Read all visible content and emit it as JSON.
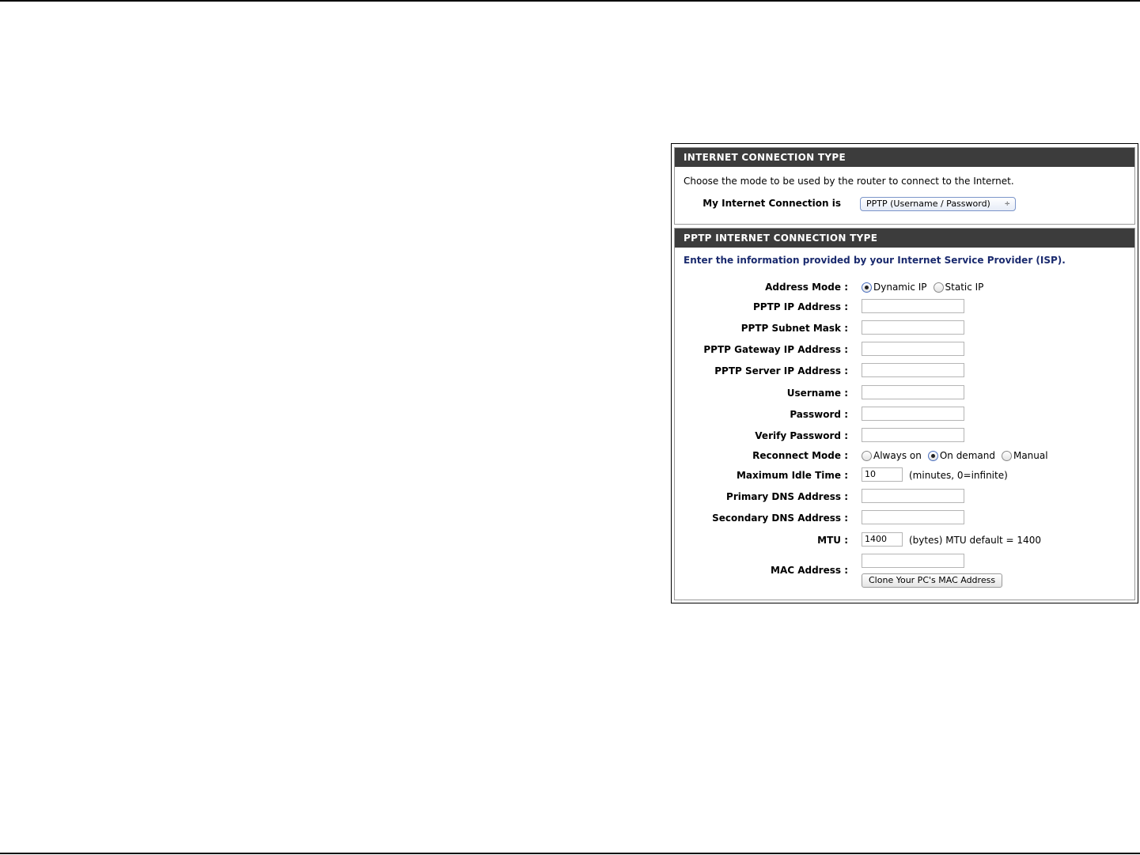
{
  "connection_type": {
    "header": "INTERNET CONNECTION TYPE",
    "intro": "Choose the mode to be used by the router to connect to the Internet.",
    "select_label": "My Internet Connection is",
    "select_value": "PPTP (Username / Password)",
    "select_arrows": "÷"
  },
  "pptp": {
    "header": "PPTP INTERNET CONNECTION TYPE",
    "intro": "Enter the information provided by your Internet Service Provider (ISP).",
    "address_mode_label": "Address Mode :",
    "address_mode_options": [
      "Dynamic IP",
      "Static IP"
    ],
    "address_mode_selected": "Dynamic IP",
    "ip_address_label": "PPTP IP Address :",
    "subnet_mask_label": "PPTP Subnet Mask :",
    "gateway_label": "PPTP Gateway IP Address :",
    "server_label": "PPTP Server IP Address :",
    "username_label": "Username :",
    "password_label": "Password :",
    "verify_password_label": "Verify Password :",
    "reconnect_label": "Reconnect Mode :",
    "reconnect_options": [
      "Always on",
      "On demand",
      "Manual"
    ],
    "reconnect_selected": "On demand",
    "idle_time_label": "Maximum Idle Time :",
    "idle_time_value": "10",
    "idle_time_hint": "(minutes, 0=infinite)",
    "primary_dns_label": "Primary DNS Address :",
    "secondary_dns_label": "Secondary DNS Address :",
    "mtu_label": "MTU :",
    "mtu_value": "1400",
    "mtu_hint": "(bytes)  MTU default = 1400",
    "mac_label": "MAC Address :",
    "clone_button": "Clone Your PC's MAC Address"
  },
  "colors": {
    "header_bg": "#3c3c3c",
    "intro_blue": "#1a2a6e"
  }
}
